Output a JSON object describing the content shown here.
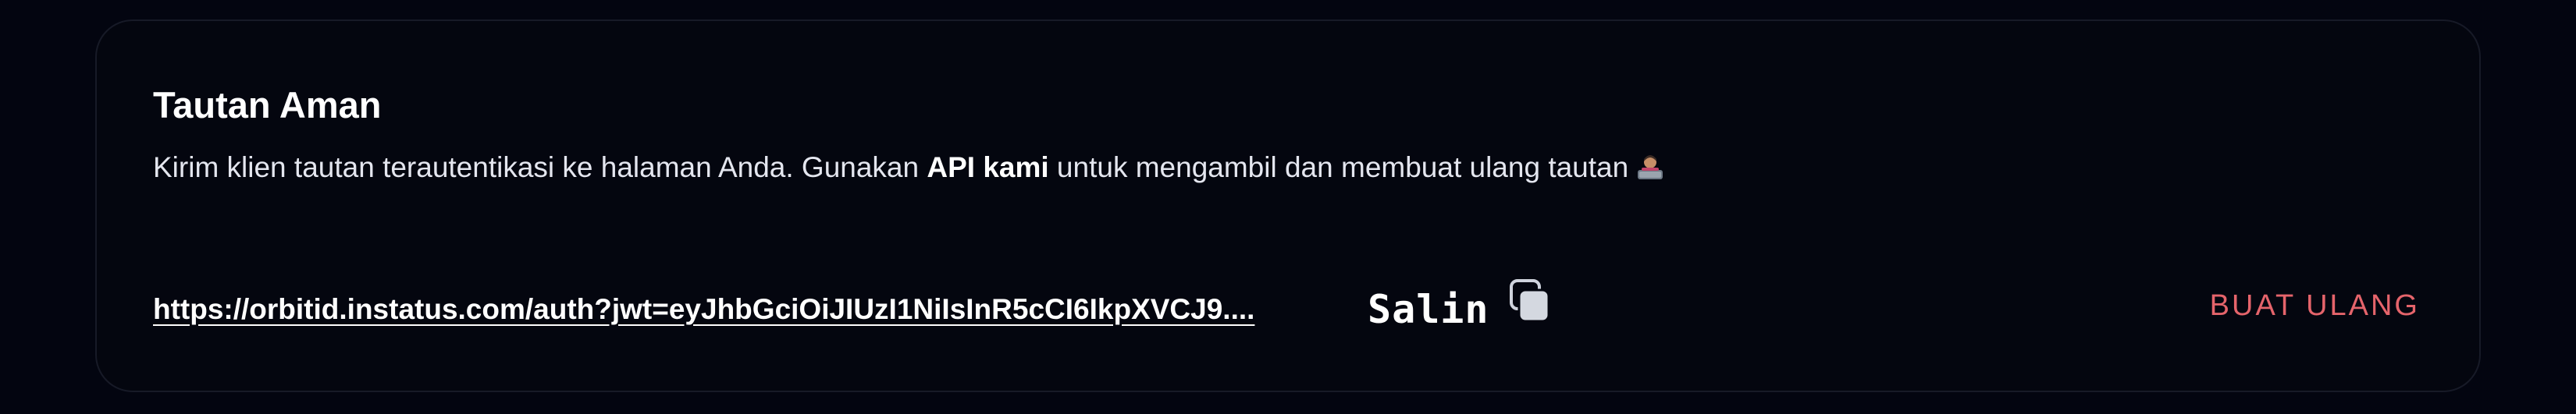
{
  "card": {
    "title": "Tautan Aman",
    "description_prefix": "Kirim klien tautan terautentikasi ke halaman Anda. Gunakan ",
    "description_link": "API kami",
    "description_suffix": " untuk mengambil dan membuat ulang tautan",
    "emoji_icon": "technologist-emoji-icon",
    "link_text": "https://orbitid.instatus.com/auth?jwt=eyJhbGciOiJIUzI1NiIsInR5cCI6IkpXVCJ9....",
    "copy_label": "Salin",
    "copy_icon": "copy-icon",
    "regenerate_label": "BUAT ULANG"
  },
  "colors": {
    "background": "#030510",
    "card_border": "#171a27",
    "accent_red": "#e5646b",
    "text_primary": "#ffffff"
  }
}
